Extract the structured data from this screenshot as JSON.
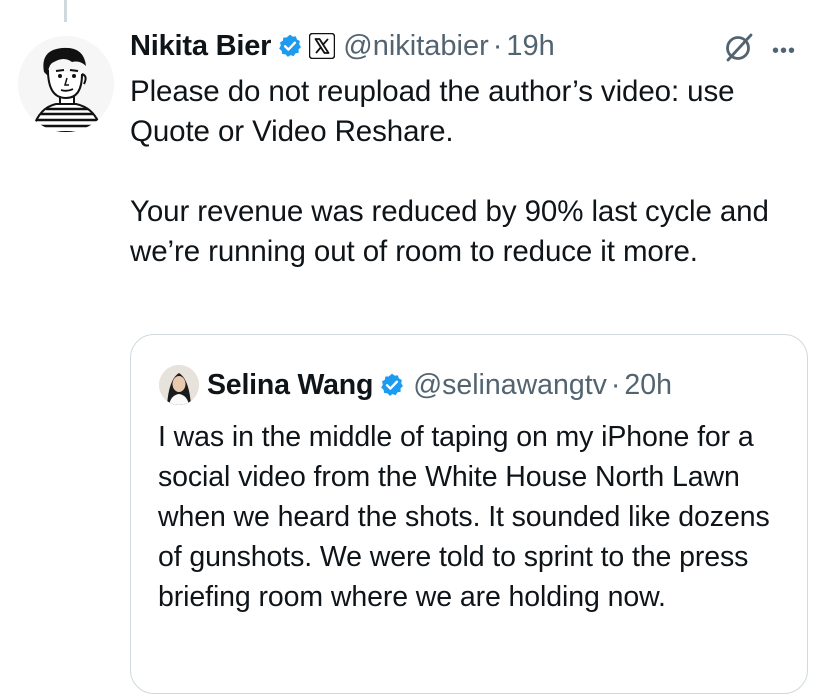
{
  "post": {
    "author_name": "Nikita Bier",
    "handle": "@nikitabier",
    "separator": "·",
    "time": "19h",
    "text": "Please do not reupload the author’s video: use Quote or Video Reshare.\n\nYour revenue was reduced by 90% last cycle and we’re running out of room to reduce it more.",
    "icons": {
      "verified": "verified-badge-icon",
      "affiliate": "x-logo-icon",
      "grok": "grok-icon",
      "more": "more-options-icon"
    }
  },
  "quoted": {
    "author_name": "Selina Wang",
    "handle": "@selinawangtv",
    "separator": "·",
    "time": "20h",
    "text": "I was in the middle of taping on my iPhone for a social video from the White House North Lawn when we heard the shots. It sounded like dozens of gunshots. We were told to sprint to the press briefing room where we are holding now."
  },
  "colors": {
    "verified": "#1d9bf0",
    "secondary_text": "#536471",
    "border": "#cfd9de",
    "text": "#0f1419"
  }
}
